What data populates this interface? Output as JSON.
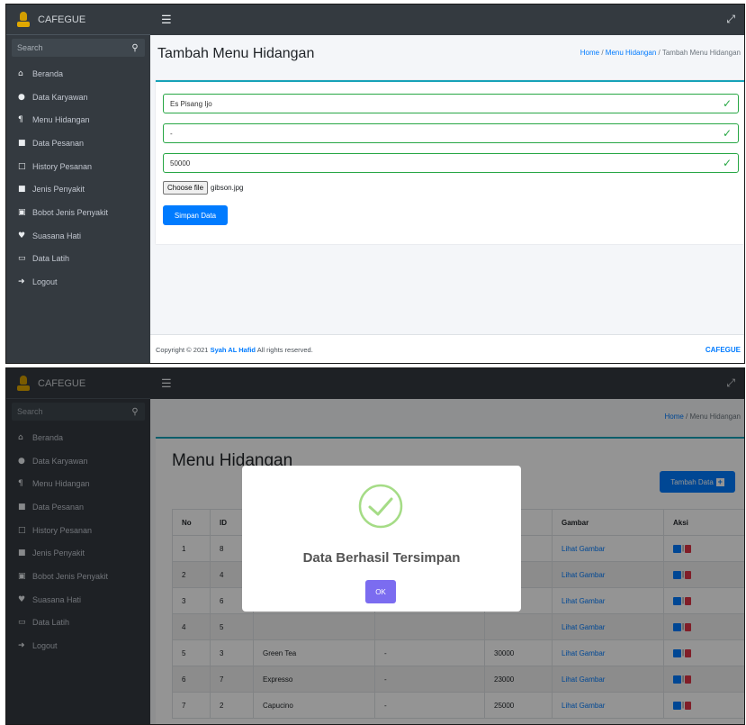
{
  "app": {
    "brand": "CAFEGUE"
  },
  "sidebar": {
    "search_label": "Search",
    "items": [
      {
        "icon": "home-icon",
        "glyph": "⌂",
        "label": "Beranda"
      },
      {
        "icon": "user-icon",
        "glyph": "●",
        "label": "Data Karyawan"
      },
      {
        "icon": "utensils-icon",
        "glyph": "¶",
        "label": "Menu Hidangan"
      },
      {
        "icon": "file-icon",
        "glyph": "■",
        "label": "Data Pesanan"
      },
      {
        "icon": "clipboard-icon",
        "glyph": "□",
        "label": "History Pesanan"
      },
      {
        "icon": "medkit-icon",
        "glyph": "■",
        "label": "Jenis Penyakit"
      },
      {
        "icon": "id-card-icon",
        "glyph": "▣",
        "label": "Bobot Jenis Penyakit"
      },
      {
        "icon": "heart-icon",
        "glyph": "♥",
        "label": "Suasana Hati"
      },
      {
        "icon": "laptop-icon",
        "glyph": "▭",
        "label": "Data Latih"
      },
      {
        "icon": "logout-icon",
        "glyph": "➜",
        "label": "Logout"
      }
    ]
  },
  "top": {
    "title": "Tambah Menu Hidangan",
    "breadcrumb": {
      "home": "Home",
      "sep": "/",
      "parent": "Menu Hidangan",
      "current": "Tambah Menu Hidangan"
    },
    "fields": {
      "name": "Es Pisang Ijo",
      "description": "-",
      "price": "50000"
    },
    "file": {
      "button": "Choose file",
      "filename": "gibson.jpg"
    },
    "submit": "Simpan Data",
    "footer": {
      "copyright": "Copyright © 2021",
      "author": "Syah AL Hafid",
      "rights": "All rights reserved.",
      "brand": "CAFEGUE"
    }
  },
  "bottom": {
    "title": "Menu Hidangan",
    "breadcrumb": {
      "home": "Home",
      "sep": "/",
      "current": "Menu Hidangan"
    },
    "add_button": "Tambah Data",
    "table": {
      "headers": [
        "No",
        "ID",
        "",
        "",
        "",
        "Gambar",
        "Aksi"
      ],
      "rows": [
        {
          "no": "1",
          "id": "8",
          "name": "",
          "desc": "",
          "price": "",
          "link": "Lihat Gambar"
        },
        {
          "no": "2",
          "id": "4",
          "name": "",
          "desc": "",
          "price": "",
          "link": "Lihat Gambar"
        },
        {
          "no": "3",
          "id": "6",
          "name": "",
          "desc": "",
          "price": "",
          "link": "Lihat Gambar"
        },
        {
          "no": "4",
          "id": "5",
          "name": "",
          "desc": "",
          "price": "",
          "link": "Lihat Gambar"
        },
        {
          "no": "5",
          "id": "3",
          "name": "Green Tea",
          "desc": "-",
          "price": "30000",
          "link": "Lihat Gambar"
        },
        {
          "no": "6",
          "id": "7",
          "name": "Expresso",
          "desc": "-",
          "price": "23000",
          "link": "Lihat Gambar"
        },
        {
          "no": "7",
          "id": "2",
          "name": "Capucino",
          "desc": "-",
          "price": "25000",
          "link": "Lihat Gambar"
        }
      ],
      "action_sep": "|"
    },
    "modal": {
      "message": "Data Berhasil Tersimpan",
      "ok": "OK"
    }
  },
  "colors": {
    "primary": "#007bff",
    "success": "#28a745",
    "sidebar": "#343a40",
    "modal_ok": "#7b6cf0"
  }
}
